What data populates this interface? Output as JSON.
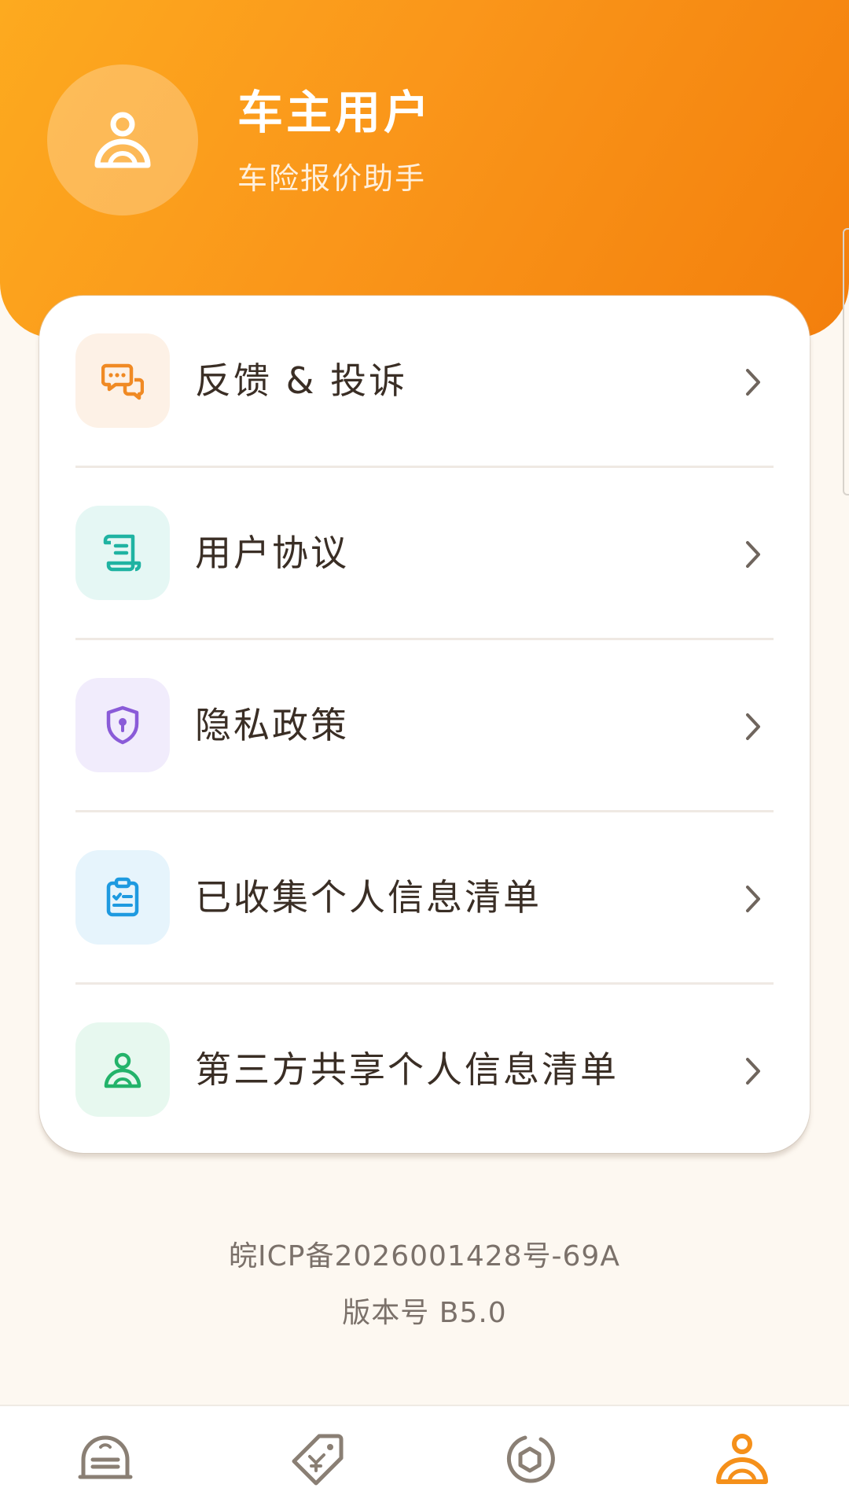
{
  "profile": {
    "name": "车主用户",
    "subtitle": "车险报价助手",
    "avatar_icon": "user-icon"
  },
  "menu": {
    "items": [
      {
        "label": "反馈 & 投诉",
        "icon": "feedback-chat-icon",
        "accent": "#f08a24",
        "bg": "#fdf1e6"
      },
      {
        "label": "用户协议",
        "icon": "agreement-scroll-icon",
        "accent": "#1fb3a2",
        "bg": "#e5f7f4"
      },
      {
        "label": "隐私政策",
        "icon": "privacy-shield-icon",
        "accent": "#8a5bd8",
        "bg": "#f1ecfc"
      },
      {
        "label": "已收集个人信息清单",
        "icon": "clipboard-checklist-icon",
        "accent": "#1e9ae0",
        "bg": "#e6f4fc"
      },
      {
        "label": "第三方共享个人信息清单",
        "icon": "shared-user-icon",
        "accent": "#23b36a",
        "bg": "#e7f8ef"
      }
    ],
    "chevron_icon": "chevron-right-icon"
  },
  "footer": {
    "icp": "皖ICP备2026001428号-69A",
    "version": "版本号 B5.0"
  },
  "tabbar": {
    "tabs": [
      {
        "icon": "garage-icon",
        "active": false
      },
      {
        "icon": "price-tag-icon",
        "active": false
      },
      {
        "icon": "ring-icon",
        "active": false
      },
      {
        "icon": "profile-icon",
        "active": true
      }
    ],
    "active_color": "#f5901a",
    "inactive_color": "#8a7f74"
  },
  "colors": {
    "header_gradient_start": "#fdaa1f",
    "header_gradient_end": "#f37f0c",
    "page_background": "#fdf8f1"
  }
}
